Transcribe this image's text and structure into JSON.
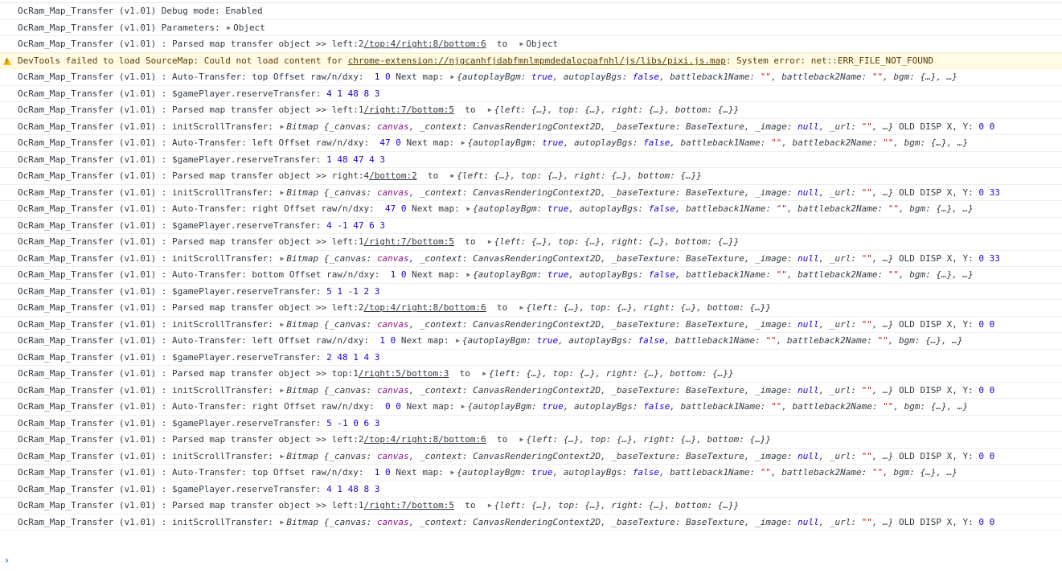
{
  "console": {
    "prompt_glyph": "›",
    "warn_icon": "warning-triangle-icon",
    "colors": {
      "number": "#1c00cf",
      "string": "#c41a16",
      "canvas": "#881280",
      "warning_bg": "#fffbe5",
      "prompt": "#367cf1"
    },
    "rows": [
      {
        "type": "log",
        "segs": [
          [
            "t",
            "OcRam_Map_Transfer (v1.01) Debug mode: Enabled"
          ]
        ]
      },
      {
        "type": "log",
        "segs": [
          [
            "t",
            "OcRam_Map_Transfer (v1.01) Parameters: "
          ],
          [
            "tri",
            "▶"
          ],
          [
            "t",
            "Object"
          ]
        ]
      },
      {
        "type": "log",
        "segs": [
          [
            "t",
            "OcRam_Map_Transfer (v1.01) : Parsed map transfer object >> left:2"
          ],
          [
            "l",
            "/top:4/right:8/bottom:6"
          ],
          [
            "t",
            "  to  "
          ],
          [
            "tri",
            "▶"
          ],
          [
            "t",
            "Object"
          ]
        ]
      },
      {
        "type": "warn",
        "segs": [
          [
            "t",
            "DevTools failed to load SourceMap: Could not load content for "
          ],
          [
            "l",
            "chrome-extension://njgcanhfjdabfmnlmpmdedalocpafnhl/js/libs/pixi.js.map"
          ],
          [
            "t",
            ": System error: net::ERR_FILE_NOT_FOUND"
          ]
        ]
      },
      {
        "type": "log",
        "segs": [
          [
            "t",
            "OcRam_Map_Transfer (v1.01) : Auto-Transfer: top Offset raw/n/dxy:  "
          ],
          [
            "n",
            "1 0"
          ],
          [
            "t",
            " Next map: "
          ],
          [
            "tri",
            "▶"
          ],
          [
            "o",
            "{autoplayBgm: "
          ],
          [
            "k",
            "true"
          ],
          [
            "o",
            ", autoplayBgs: "
          ],
          [
            "k",
            "false"
          ],
          [
            "o",
            ", battleback1Name: "
          ],
          [
            "s",
            "\"\""
          ],
          [
            "o",
            ", battleback2Name: "
          ],
          [
            "s",
            "\"\""
          ],
          [
            "o",
            ", bgm: {…}, …}"
          ]
        ]
      },
      {
        "type": "log",
        "segs": [
          [
            "t",
            "OcRam_Map_Transfer (v1.01) : $gamePlayer.reserveTransfer: "
          ],
          [
            "n",
            "4 1 48 8 3"
          ]
        ]
      },
      {
        "type": "log",
        "segs": [
          [
            "t",
            "OcRam_Map_Transfer (v1.01) : Parsed map transfer object >> left:1"
          ],
          [
            "l",
            "/right:7/bottom:5"
          ],
          [
            "t",
            "  to  "
          ],
          [
            "tri",
            "▶"
          ],
          [
            "o",
            "{left: {…}, top: {…}, right: {…}, bottom: {…}}"
          ]
        ]
      },
      {
        "type": "log",
        "segs": [
          [
            "t",
            "OcRam_Map_Transfer (v1.01) : initScrollTransfer: "
          ],
          [
            "tri",
            "▶"
          ],
          [
            "o",
            "Bitmap {_canvas: "
          ],
          [
            "c",
            "canvas"
          ],
          [
            "o",
            ", _context: CanvasRenderingContext2D, _baseTexture: BaseTexture, _image: "
          ],
          [
            "k",
            "null"
          ],
          [
            "o",
            ", _url: "
          ],
          [
            "s",
            "\"\""
          ],
          [
            "o",
            ", …}"
          ],
          [
            "t",
            " OLD DISP X, Y: "
          ],
          [
            "n",
            "0 0"
          ]
        ]
      },
      {
        "type": "log",
        "segs": [
          [
            "t",
            "OcRam_Map_Transfer (v1.01) : Auto-Transfer: left Offset raw/n/dxy:  "
          ],
          [
            "n",
            "47 0"
          ],
          [
            "t",
            " Next map: "
          ],
          [
            "tri",
            "▶"
          ],
          [
            "o",
            "{autoplayBgm: "
          ],
          [
            "k",
            "true"
          ],
          [
            "o",
            ", autoplayBgs: "
          ],
          [
            "k",
            "false"
          ],
          [
            "o",
            ", battleback1Name: "
          ],
          [
            "s",
            "\"\""
          ],
          [
            "o",
            ", battleback2Name: "
          ],
          [
            "s",
            "\"\""
          ],
          [
            "o",
            ", bgm: {…}, …}"
          ]
        ]
      },
      {
        "type": "log",
        "segs": [
          [
            "t",
            "OcRam_Map_Transfer (v1.01) : $gamePlayer.reserveTransfer: "
          ],
          [
            "n",
            "1 48 47 4 3"
          ]
        ]
      },
      {
        "type": "log",
        "segs": [
          [
            "t",
            "OcRam_Map_Transfer (v1.01) : Parsed map transfer object >> right:4"
          ],
          [
            "l",
            "/bottom:2"
          ],
          [
            "t",
            "  to  "
          ],
          [
            "tri",
            "▶"
          ],
          [
            "o",
            "{left: {…}, top: {…}, right: {…}, bottom: {…}}"
          ]
        ]
      },
      {
        "type": "log",
        "segs": [
          [
            "t",
            "OcRam_Map_Transfer (v1.01) : initScrollTransfer: "
          ],
          [
            "tri",
            "▶"
          ],
          [
            "o",
            "Bitmap {_canvas: "
          ],
          [
            "c",
            "canvas"
          ],
          [
            "o",
            ", _context: CanvasRenderingContext2D, _baseTexture: BaseTexture, _image: "
          ],
          [
            "k",
            "null"
          ],
          [
            "o",
            ", _url: "
          ],
          [
            "s",
            "\"\""
          ],
          [
            "o",
            ", …}"
          ],
          [
            "t",
            " OLD DISP X, Y: "
          ],
          [
            "n",
            "0 33"
          ]
        ]
      },
      {
        "type": "log",
        "segs": [
          [
            "t",
            "OcRam_Map_Transfer (v1.01) : Auto-Transfer: right Offset raw/n/dxy:  "
          ],
          [
            "n",
            "47 0"
          ],
          [
            "t",
            " Next map: "
          ],
          [
            "tri",
            "▶"
          ],
          [
            "o",
            "{autoplayBgm: "
          ],
          [
            "k",
            "true"
          ],
          [
            "o",
            ", autoplayBgs: "
          ],
          [
            "k",
            "false"
          ],
          [
            "o",
            ", battleback1Name: "
          ],
          [
            "s",
            "\"\""
          ],
          [
            "o",
            ", battleback2Name: "
          ],
          [
            "s",
            "\"\""
          ],
          [
            "o",
            ", bgm: {…}, …}"
          ]
        ]
      },
      {
        "type": "log",
        "segs": [
          [
            "t",
            "OcRam_Map_Transfer (v1.01) : $gamePlayer.reserveTransfer: "
          ],
          [
            "n",
            "4 -1 47 6 3"
          ]
        ]
      },
      {
        "type": "log",
        "segs": [
          [
            "t",
            "OcRam_Map_Transfer (v1.01) : Parsed map transfer object >> left:1"
          ],
          [
            "l",
            "/right:7/bottom:5"
          ],
          [
            "t",
            "  to  "
          ],
          [
            "tri",
            "▶"
          ],
          [
            "o",
            "{left: {…}, top: {…}, right: {…}, bottom: {…}}"
          ]
        ]
      },
      {
        "type": "log",
        "segs": [
          [
            "t",
            "OcRam_Map_Transfer (v1.01) : initScrollTransfer: "
          ],
          [
            "tri",
            "▶"
          ],
          [
            "o",
            "Bitmap {_canvas: "
          ],
          [
            "c",
            "canvas"
          ],
          [
            "o",
            ", _context: CanvasRenderingContext2D, _baseTexture: BaseTexture, _image: "
          ],
          [
            "k",
            "null"
          ],
          [
            "o",
            ", _url: "
          ],
          [
            "s",
            "\"\""
          ],
          [
            "o",
            ", …}"
          ],
          [
            "t",
            " OLD DISP X, Y: "
          ],
          [
            "n",
            "0 33"
          ]
        ]
      },
      {
        "type": "log",
        "segs": [
          [
            "t",
            "OcRam_Map_Transfer (v1.01) : Auto-Transfer: bottom Offset raw/n/dxy:  "
          ],
          [
            "n",
            "1 0"
          ],
          [
            "t",
            " Next map: "
          ],
          [
            "tri",
            "▶"
          ],
          [
            "o",
            "{autoplayBgm: "
          ],
          [
            "k",
            "true"
          ],
          [
            "o",
            ", autoplayBgs: "
          ],
          [
            "k",
            "false"
          ],
          [
            "o",
            ", battleback1Name: "
          ],
          [
            "s",
            "\"\""
          ],
          [
            "o",
            ", battleback2Name: "
          ],
          [
            "s",
            "\"\""
          ],
          [
            "o",
            ", bgm: {…}, …}"
          ]
        ]
      },
      {
        "type": "log",
        "segs": [
          [
            "t",
            "OcRam_Map_Transfer (v1.01) : $gamePlayer.reserveTransfer: "
          ],
          [
            "n",
            "5 1 -1 2 3"
          ]
        ]
      },
      {
        "type": "log",
        "segs": [
          [
            "t",
            "OcRam_Map_Transfer (v1.01) : Parsed map transfer object >> left:2"
          ],
          [
            "l",
            "/top:4/right:8/bottom:6"
          ],
          [
            "t",
            "  to  "
          ],
          [
            "tri",
            "▶"
          ],
          [
            "o",
            "{left: {…}, top: {…}, right: {…}, bottom: {…}}"
          ]
        ]
      },
      {
        "type": "log",
        "segs": [
          [
            "t",
            "OcRam_Map_Transfer (v1.01) : initScrollTransfer: "
          ],
          [
            "tri",
            "▶"
          ],
          [
            "o",
            "Bitmap {_canvas: "
          ],
          [
            "c",
            "canvas"
          ],
          [
            "o",
            ", _context: CanvasRenderingContext2D, _baseTexture: BaseTexture, _image: "
          ],
          [
            "k",
            "null"
          ],
          [
            "o",
            ", _url: "
          ],
          [
            "s",
            "\"\""
          ],
          [
            "o",
            ", …}"
          ],
          [
            "t",
            " OLD DISP X, Y: "
          ],
          [
            "n",
            "0 0"
          ]
        ]
      },
      {
        "type": "log",
        "segs": [
          [
            "t",
            "OcRam_Map_Transfer (v1.01) : Auto-Transfer: left Offset raw/n/dxy:  "
          ],
          [
            "n",
            "1 0"
          ],
          [
            "t",
            " Next map: "
          ],
          [
            "tri",
            "▶"
          ],
          [
            "o",
            "{autoplayBgm: "
          ],
          [
            "k",
            "true"
          ],
          [
            "o",
            ", autoplayBgs: "
          ],
          [
            "k",
            "false"
          ],
          [
            "o",
            ", battleback1Name: "
          ],
          [
            "s",
            "\"\""
          ],
          [
            "o",
            ", battleback2Name: "
          ],
          [
            "s",
            "\"\""
          ],
          [
            "o",
            ", bgm: {…}, …}"
          ]
        ]
      },
      {
        "type": "log",
        "segs": [
          [
            "t",
            "OcRam_Map_Transfer (v1.01) : $gamePlayer.reserveTransfer: "
          ],
          [
            "n",
            "2 48 1 4 3"
          ]
        ]
      },
      {
        "type": "log",
        "segs": [
          [
            "t",
            "OcRam_Map_Transfer (v1.01) : Parsed map transfer object >> top:1"
          ],
          [
            "l",
            "/right:5/bottom:3"
          ],
          [
            "t",
            "  to  "
          ],
          [
            "tri",
            "▶"
          ],
          [
            "o",
            "{left: {…}, top: {…}, right: {…}, bottom: {…}}"
          ]
        ]
      },
      {
        "type": "log",
        "segs": [
          [
            "t",
            "OcRam_Map_Transfer (v1.01) : initScrollTransfer: "
          ],
          [
            "tri",
            "▶"
          ],
          [
            "o",
            "Bitmap {_canvas: "
          ],
          [
            "c",
            "canvas"
          ],
          [
            "o",
            ", _context: CanvasRenderingContext2D, _baseTexture: BaseTexture, _image: "
          ],
          [
            "k",
            "null"
          ],
          [
            "o",
            ", _url: "
          ],
          [
            "s",
            "\"\""
          ],
          [
            "o",
            ", …}"
          ],
          [
            "t",
            " OLD DISP X, Y: "
          ],
          [
            "n",
            "0 0"
          ]
        ]
      },
      {
        "type": "log",
        "segs": [
          [
            "t",
            "OcRam_Map_Transfer (v1.01) : Auto-Transfer: right Offset raw/n/dxy:  "
          ],
          [
            "n",
            "0 0"
          ],
          [
            "t",
            " Next map: "
          ],
          [
            "tri",
            "▶"
          ],
          [
            "o",
            "{autoplayBgm: "
          ],
          [
            "k",
            "true"
          ],
          [
            "o",
            ", autoplayBgs: "
          ],
          [
            "k",
            "false"
          ],
          [
            "o",
            ", battleback1Name: "
          ],
          [
            "s",
            "\"\""
          ],
          [
            "o",
            ", battleback2Name: "
          ],
          [
            "s",
            "\"\""
          ],
          [
            "o",
            ", bgm: {…}, …}"
          ]
        ]
      },
      {
        "type": "log",
        "segs": [
          [
            "t",
            "OcRam_Map_Transfer (v1.01) : $gamePlayer.reserveTransfer: "
          ],
          [
            "n",
            "5 -1 0 6 3"
          ]
        ]
      },
      {
        "type": "log",
        "segs": [
          [
            "t",
            "OcRam_Map_Transfer (v1.01) : Parsed map transfer object >> left:2"
          ],
          [
            "l",
            "/top:4/right:8/bottom:6"
          ],
          [
            "t",
            "  to  "
          ],
          [
            "tri",
            "▶"
          ],
          [
            "o",
            "{left: {…}, top: {…}, right: {…}, bottom: {…}}"
          ]
        ]
      },
      {
        "type": "log",
        "segs": [
          [
            "t",
            "OcRam_Map_Transfer (v1.01) : initScrollTransfer: "
          ],
          [
            "tri",
            "▶"
          ],
          [
            "o",
            "Bitmap {_canvas: "
          ],
          [
            "c",
            "canvas"
          ],
          [
            "o",
            ", _context: CanvasRenderingContext2D, _baseTexture: BaseTexture, _image: "
          ],
          [
            "k",
            "null"
          ],
          [
            "o",
            ", _url: "
          ],
          [
            "s",
            "\"\""
          ],
          [
            "o",
            ", …}"
          ],
          [
            "t",
            " OLD DISP X, Y: "
          ],
          [
            "n",
            "0 0"
          ]
        ]
      },
      {
        "type": "log",
        "segs": [
          [
            "t",
            "OcRam_Map_Transfer (v1.01) : Auto-Transfer: top Offset raw/n/dxy:  "
          ],
          [
            "n",
            "1 0"
          ],
          [
            "t",
            " Next map: "
          ],
          [
            "tri",
            "▶"
          ],
          [
            "o",
            "{autoplayBgm: "
          ],
          [
            "k",
            "true"
          ],
          [
            "o",
            ", autoplayBgs: "
          ],
          [
            "k",
            "false"
          ],
          [
            "o",
            ", battleback1Name: "
          ],
          [
            "s",
            "\"\""
          ],
          [
            "o",
            ", battleback2Name: "
          ],
          [
            "s",
            "\"\""
          ],
          [
            "o",
            ", bgm: {…}, …}"
          ]
        ]
      },
      {
        "type": "log",
        "segs": [
          [
            "t",
            "OcRam_Map_Transfer (v1.01) : $gamePlayer.reserveTransfer: "
          ],
          [
            "n",
            "4 1 48 8 3"
          ]
        ]
      },
      {
        "type": "log",
        "segs": [
          [
            "t",
            "OcRam_Map_Transfer (v1.01) : Parsed map transfer object >> left:1"
          ],
          [
            "l",
            "/right:7/bottom:5"
          ],
          [
            "t",
            "  to  "
          ],
          [
            "tri",
            "▶"
          ],
          [
            "o",
            "{left: {…}, top: {…}, right: {…}, bottom: {…}}"
          ]
        ]
      },
      {
        "type": "log",
        "segs": [
          [
            "t",
            "OcRam_Map_Transfer (v1.01) : initScrollTransfer: "
          ],
          [
            "tri",
            "▶"
          ],
          [
            "o",
            "Bitmap {_canvas: "
          ],
          [
            "c",
            "canvas"
          ],
          [
            "o",
            ", _context: CanvasRenderingContext2D, _baseTexture: BaseTexture, _image: "
          ],
          [
            "k",
            "null"
          ],
          [
            "o",
            ", _url: "
          ],
          [
            "s",
            "\"\""
          ],
          [
            "o",
            ", …}"
          ],
          [
            "t",
            " OLD DISP X, Y: "
          ],
          [
            "n",
            "0 0"
          ]
        ]
      }
    ]
  }
}
